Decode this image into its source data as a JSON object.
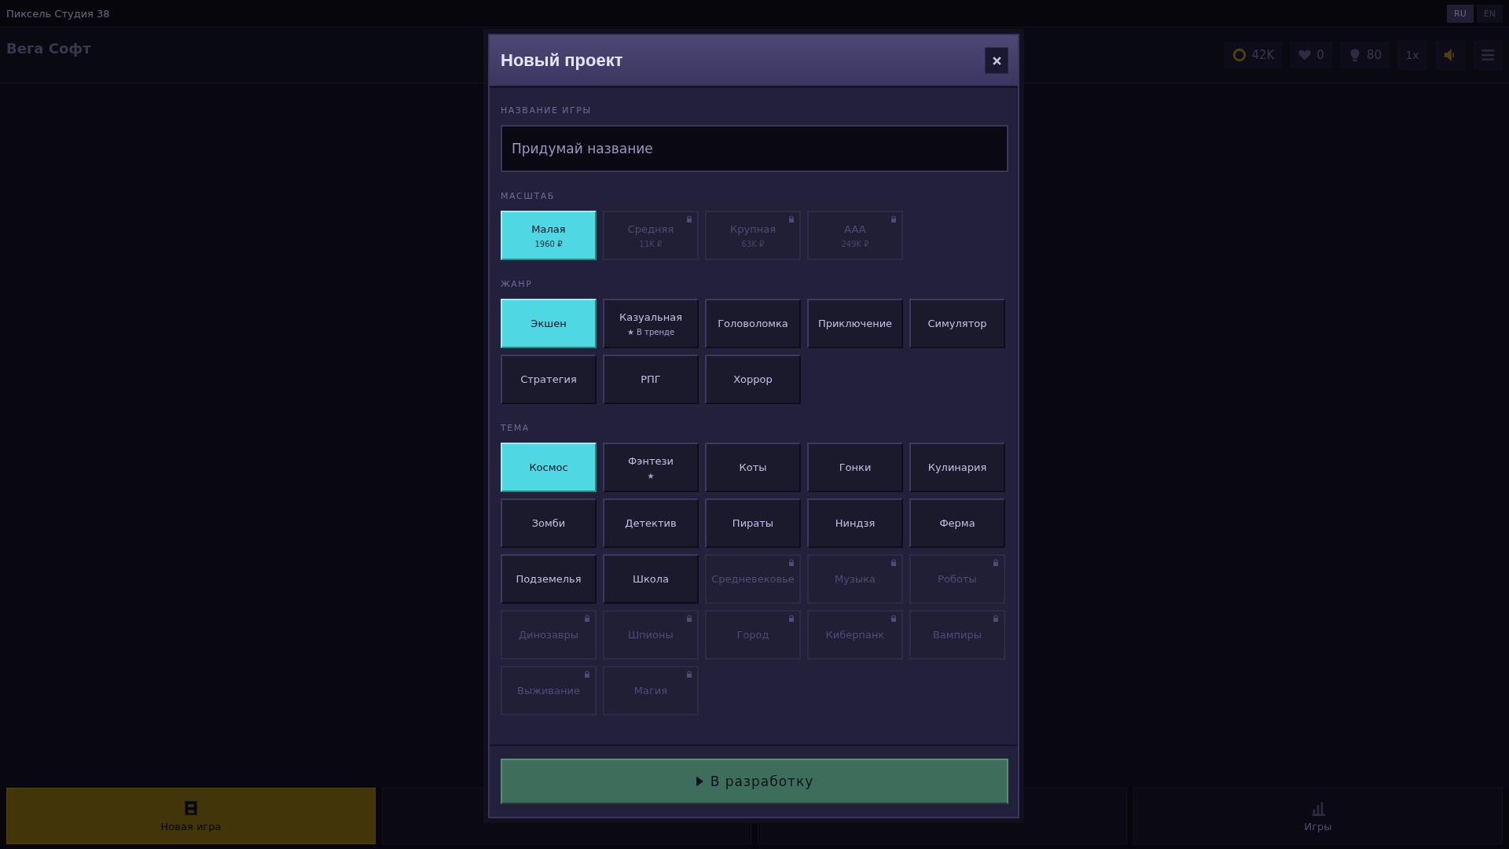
{
  "app_bar": {
    "title": "Пиксель Студия 38",
    "languages": [
      {
        "label": "RU",
        "selected": true
      },
      {
        "label": "EN",
        "selected": false
      }
    ]
  },
  "studio": {
    "name": "Вега Софт"
  },
  "stats": [
    {
      "kind": "coins",
      "value": "42K"
    },
    {
      "kind": "hearts",
      "value": "0"
    },
    {
      "kind": "ideas",
      "value": "80"
    }
  ],
  "speed": "1x",
  "bottom_nav": [
    {
      "kind": "new",
      "label": "Новая игра",
      "selected": true
    },
    {
      "selected": false
    },
    {
      "selected": false
    },
    {
      "kind": "stats",
      "label": "Игры",
      "selected": false
    }
  ],
  "dialog": {
    "title": "Новый проект",
    "name_field": {
      "label": "НАЗВАНИЕ ИГРЫ",
      "placeholder": "Придумай название"
    },
    "groups": [
      {
        "label": "МАСШТАБ",
        "options": [
          {
            "title": "Малая",
            "sub": "1960 ₽",
            "selected": true,
            "locked": false
          },
          {
            "title": "Средняя",
            "sub": "11K ₽",
            "selected": false,
            "locked": true
          },
          {
            "title": "Крупная",
            "sub": "63K ₽",
            "selected": false,
            "locked": true
          },
          {
            "title": "AAA",
            "sub": "249K ₽",
            "selected": false,
            "locked": true
          }
        ]
      },
      {
        "label": "ЖАНР",
        "options": [
          {
            "title": "Экшен",
            "selected": true,
            "locked": false
          },
          {
            "title": "Казуальная",
            "sub": "★ В тренде",
            "selected": false,
            "locked": false
          },
          {
            "title": "Головоломка",
            "selected": false,
            "locked": false
          },
          {
            "title": "Приключение",
            "selected": false,
            "locked": false
          },
          {
            "title": "Симулятор",
            "selected": false,
            "locked": false
          },
          {
            "title": "Стратегия",
            "selected": false,
            "locked": false
          },
          {
            "title": "РПГ",
            "selected": false,
            "locked": false
          },
          {
            "title": "Хоррор",
            "selected": false,
            "locked": false
          }
        ]
      },
      {
        "label": "ТЕМА",
        "options": [
          {
            "title": "Космос",
            "selected": true,
            "locked": false
          },
          {
            "title": "Фэнтези",
            "sub": "★",
            "selected": false,
            "locked": false
          },
          {
            "title": "Коты",
            "selected": false,
            "locked": false
          },
          {
            "title": "Гонки",
            "selected": false,
            "locked": false
          },
          {
            "title": "Кулинария",
            "selected": false,
            "locked": false
          },
          {
            "title": "Зомби",
            "selected": false,
            "locked": false
          },
          {
            "title": "Детектив",
            "selected": false,
            "locked": false
          },
          {
            "title": "Пираты",
            "selected": false,
            "locked": false
          },
          {
            "title": "Ниндзя",
            "selected": false,
            "locked": false
          },
          {
            "title": "Ферма",
            "selected": false,
            "locked": false
          },
          {
            "title": "Подземелья",
            "selected": false,
            "locked": false
          },
          {
            "title": "Школа",
            "selected": false,
            "locked": false
          },
          {
            "title": "Средневековье",
            "selected": false,
            "locked": true
          },
          {
            "title": "Музыка",
            "selected": false,
            "locked": true
          },
          {
            "title": "Роботы",
            "selected": false,
            "locked": true
          },
          {
            "title": "Динозавры",
            "selected": false,
            "locked": true
          },
          {
            "title": "Шпионы",
            "selected": false,
            "locked": true
          },
          {
            "title": "Город",
            "selected": false,
            "locked": true
          },
          {
            "title": "Киберпанк",
            "selected": false,
            "locked": true
          },
          {
            "title": "Вампиры",
            "selected": false,
            "locked": true
          },
          {
            "title": "Выживание",
            "selected": false,
            "locked": true
          },
          {
            "title": "Магия",
            "selected": false,
            "locked": true
          }
        ]
      }
    ],
    "start_button": "В разработку"
  }
}
